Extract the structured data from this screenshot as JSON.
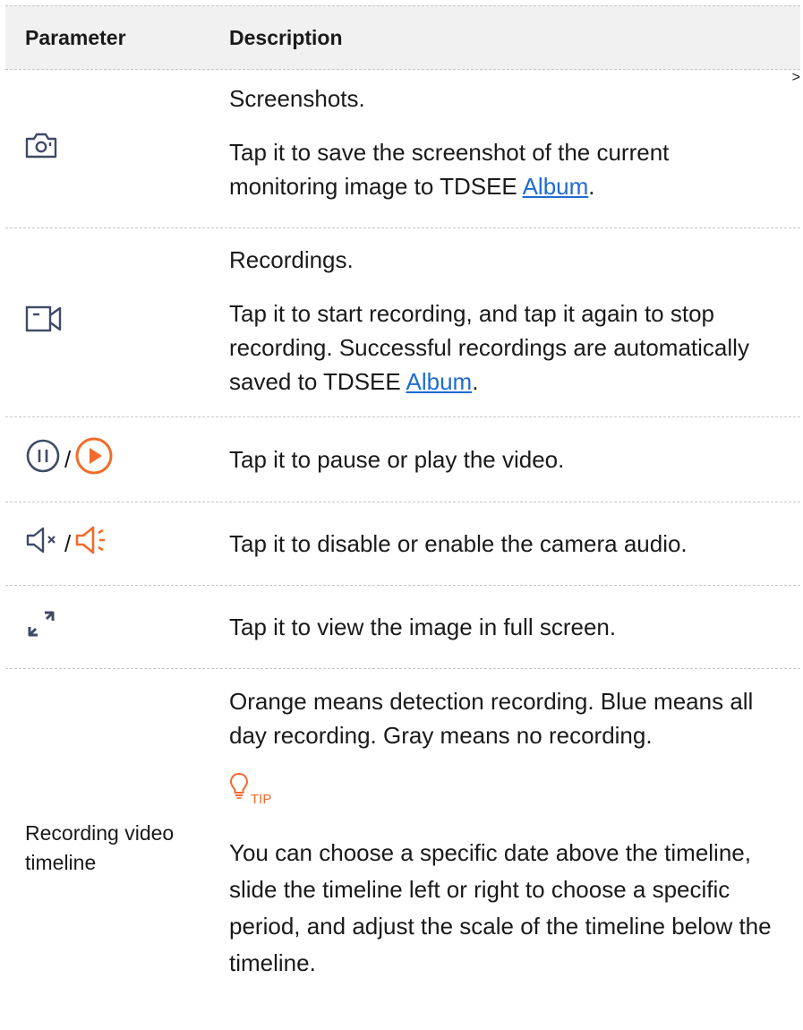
{
  "table": {
    "headers": {
      "parameter": "Parameter",
      "description": "Description"
    },
    "rows": [
      {
        "icon": "camera-screenshot-icon",
        "lines": [
          {
            "text": "Screenshots."
          },
          {
            "text": "Tap it to save the screenshot of the current monitoring image to TDSEE ",
            "link": "Album",
            "after": "."
          }
        ]
      },
      {
        "icon": "video-record-icon",
        "lines": [
          {
            "text": "Recordings."
          },
          {
            "text": "Tap it to start recording, and tap it again to stop recording. Successful recordings are automatically saved to TDSEE ",
            "link": "Album",
            "after": "."
          }
        ]
      },
      {
        "icons": [
          "pause-circle-icon",
          "play-circle-icon"
        ],
        "separator": "/",
        "text": "Tap it to pause or play the video."
      },
      {
        "icons": [
          "speaker-muted-icon",
          "speaker-on-icon"
        ],
        "separator": "/",
        "text": "Tap it to disable or enable the camera audio."
      },
      {
        "icon": "fullscreen-arrows-icon",
        "text": "Tap it to view the image in full screen."
      },
      {
        "parameter": "Recording video timeline",
        "text": "Orange means detection recording. Blue means all day recording. Gray means no recording.",
        "tip": {
          "icon": "lightbulb-icon",
          "label": "TIP",
          "text": "You can choose a specific date above the timeline, slide the timeline left or right to choose a specific period, and adjust the scale of the timeline below the timeline."
        }
      }
    ]
  },
  "colors": {
    "icon_gray": "#3f4a66",
    "accent_orange": "#f26b2b",
    "link_blue": "#1f6bd1",
    "header_bg": "#f1f1f1"
  }
}
